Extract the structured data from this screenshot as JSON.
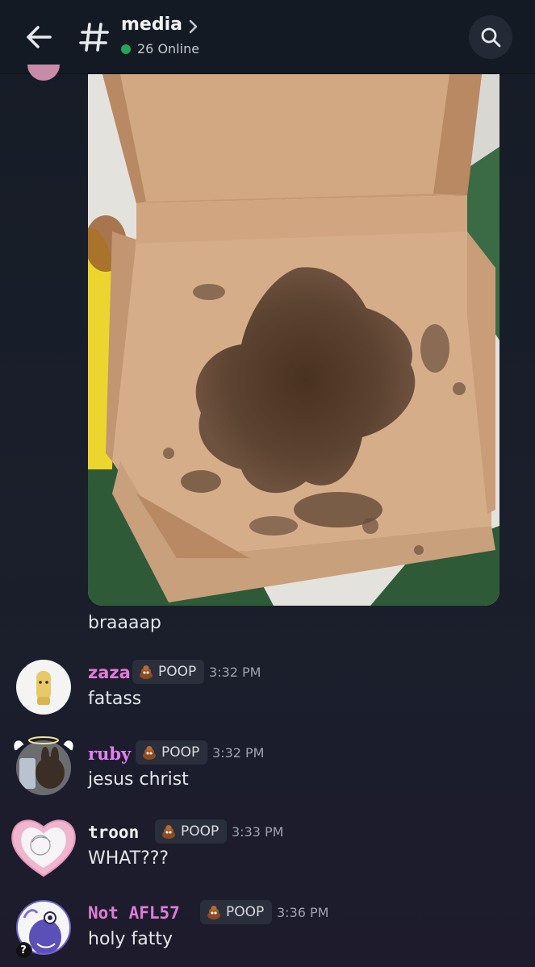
{
  "header": {
    "channel_name": "media",
    "online_count": "26 Online"
  },
  "attachment": {
    "caption": "braaaap"
  },
  "messages": [
    {
      "username": "zaza",
      "name_color": "#e27bd8",
      "tag": "POOP",
      "time": "3:32 PM",
      "text": "fatass"
    },
    {
      "username": "ruby",
      "name_color": "#e47ff2",
      "tag": "POOP",
      "time": "3:32 PM",
      "text": "jesus christ"
    },
    {
      "username": "troon",
      "name_color": "#f2f3f5",
      "tag": "POOP",
      "time": "3:33 PM",
      "text": "WHAT???"
    },
    {
      "username": "Not AFL57",
      "name_color": "#e27bd8",
      "tag": "POOP",
      "time": "3:36 PM",
      "text": "holy fatty"
    }
  ],
  "icons": {
    "back": "arrow-left-icon",
    "channel": "hash-icon",
    "chevron": "chevron-right-icon",
    "search": "search-icon",
    "tag": "poop-role-icon",
    "status": "question-status-icon"
  },
  "colors": {
    "online": "#23a55a",
    "header_bg": "#141a23",
    "tag_bg": "#2a2f3b"
  }
}
